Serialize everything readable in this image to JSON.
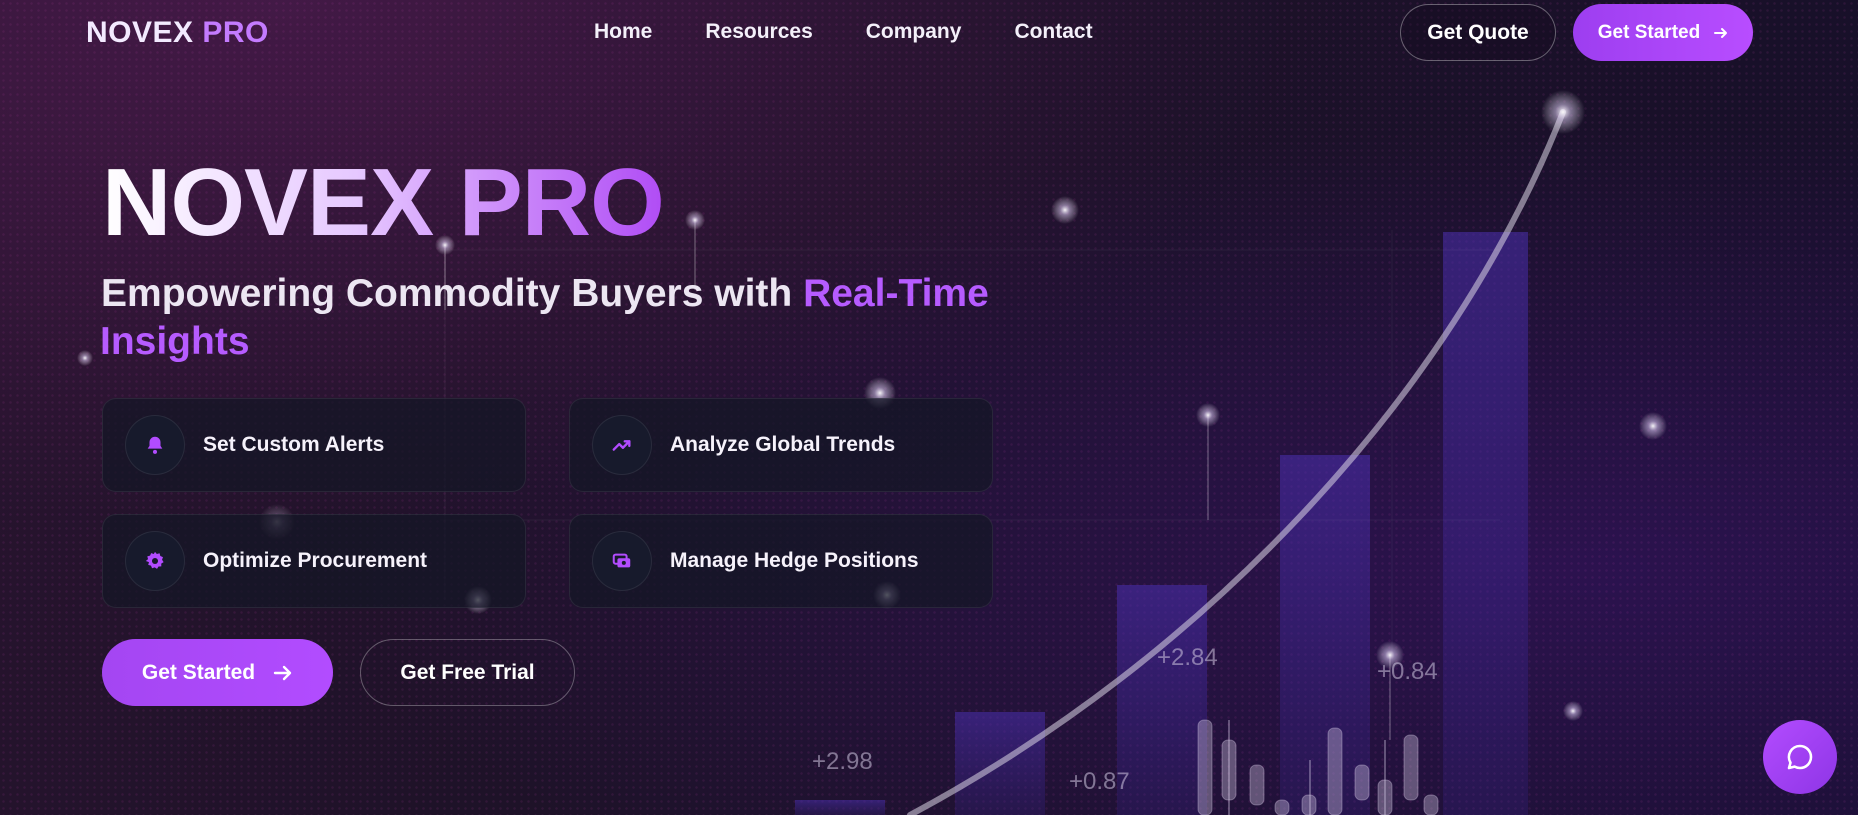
{
  "brand": {
    "name_part1": "NOVEX",
    "name_part2": "PRO"
  },
  "nav": {
    "links": [
      "Home",
      "Resources",
      "Company",
      "Contact"
    ],
    "quote_label": "Get Quote",
    "start_label": "Get Started"
  },
  "hero": {
    "title": "NOVEX PRO",
    "subtitle_plain": "Empowering Commodity Buyers with ",
    "subtitle_highlight_1": "Real-Time",
    "subtitle_highlight_2": "Insights",
    "features": [
      {
        "label": "Set Custom Alerts",
        "icon": "bell-icon"
      },
      {
        "label": "Analyze Global Trends",
        "icon": "trending-up-icon"
      },
      {
        "label": "Optimize Procurement",
        "icon": "gear-icon"
      },
      {
        "label": "Manage Hedge Positions",
        "icon": "money-cards-icon"
      }
    ],
    "cta_primary": "Get Started",
    "cta_secondary": "Get Free Trial"
  },
  "background_labels": [
    "+2.84",
    "+0.84",
    "+2.98",
    "+0.87"
  ],
  "colors": {
    "accent": "#b24cff",
    "background": "#1c1129",
    "card": "#14162a"
  },
  "chat": {
    "icon": "chat-bubble-icon"
  }
}
